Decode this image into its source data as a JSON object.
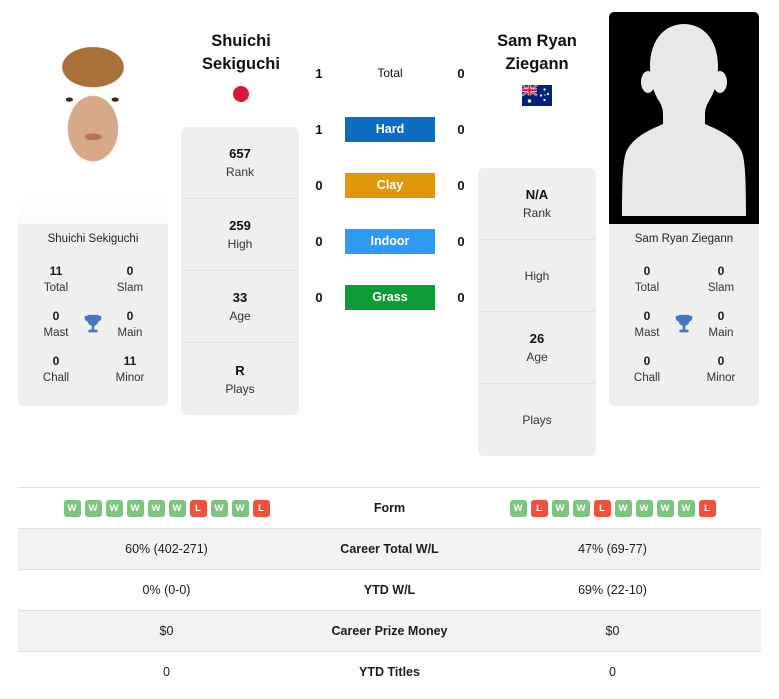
{
  "players": {
    "left": {
      "name": "Shuichi Sekiguchi",
      "name_line1": "Shuichi",
      "name_line2": "Sekiguchi",
      "country_flag": "japan-flag",
      "photo": "player-photo",
      "caption": "Shuichi Sekiguchi",
      "titles": {
        "total": "11",
        "total_label": "Total",
        "slam": "0",
        "slam_label": "Slam",
        "mast": "0",
        "mast_label": "Mast",
        "main": "0",
        "main_label": "Main",
        "chall": "0",
        "chall_label": "Chall",
        "minor": "11",
        "minor_label": "Minor"
      },
      "stats": [
        {
          "value": "657",
          "label": "Rank"
        },
        {
          "value": "259",
          "label": "High"
        },
        {
          "value": "33",
          "label": "Age"
        },
        {
          "value": "R",
          "label": "Plays"
        }
      ],
      "form": [
        "W",
        "W",
        "W",
        "W",
        "W",
        "W",
        "L",
        "W",
        "W",
        "L"
      ],
      "career_total_wl": "60% (402-271)",
      "ytd_wl": "0% (0-0)",
      "career_prize_money": "$0",
      "ytd_titles": "0"
    },
    "right": {
      "name": "Sam Ryan Ziegann",
      "name_line1": "Sam Ryan",
      "name_line2": "Ziegann",
      "country_flag": "australia-flag",
      "photo": "player-photo-placeholder",
      "caption": "Sam Ryan Ziegann",
      "titles": {
        "total": "0",
        "total_label": "Total",
        "slam": "0",
        "slam_label": "Slam",
        "mast": "0",
        "mast_label": "Mast",
        "main": "0",
        "main_label": "Main",
        "chall": "0",
        "chall_label": "Chall",
        "minor": "0",
        "minor_label": "Minor"
      },
      "stats": [
        {
          "value": "N/A",
          "label": "Rank"
        },
        {
          "value": "",
          "label": "High"
        },
        {
          "value": "26",
          "label": "Age"
        },
        {
          "value": "",
          "label": "Plays"
        }
      ],
      "form": [
        "W",
        "L",
        "W",
        "W",
        "L",
        "W",
        "W",
        "W",
        "W",
        "L"
      ],
      "career_total_wl": "47% (69-77)",
      "ytd_wl": "69% (22-10)",
      "career_prize_money": "$0",
      "ytd_titles": "0"
    }
  },
  "head_to_head": [
    {
      "surface": "Total",
      "left": "1",
      "right": "0",
      "color": "",
      "style": "plain"
    },
    {
      "surface": "Hard",
      "left": "1",
      "right": "0",
      "color": "#0d6cbf",
      "style": "filled"
    },
    {
      "surface": "Clay",
      "left": "0",
      "right": "0",
      "color": "#e1970a",
      "style": "filled"
    },
    {
      "surface": "Indoor",
      "left": "0",
      "right": "0",
      "color": "#2f9af5",
      "style": "filled"
    },
    {
      "surface": "Grass",
      "left": "0",
      "right": "0",
      "color": "#0f9b35",
      "style": "filled"
    }
  ],
  "table_rows": [
    {
      "label": "Form",
      "type": "form",
      "left": "",
      "right": ""
    },
    {
      "label": "Career Total W/L",
      "type": "text",
      "left": "60% (402-271)",
      "right": "47% (69-77)"
    },
    {
      "label": "YTD W/L",
      "type": "text",
      "left": "0% (0-0)",
      "right": "69% (22-10)"
    },
    {
      "label": "Career Prize Money",
      "type": "text",
      "left": "$0",
      "right": "$0"
    },
    {
      "label": "YTD Titles",
      "type": "text",
      "left": "0",
      "right": "0"
    }
  ],
  "colors": {
    "hard": "#0d6cbf",
    "clay": "#e1970a",
    "indoor": "#2f9af5",
    "grass": "#0f9b35",
    "win_badge": "#7cc47f",
    "loss_badge": "#f0503c",
    "card_bg": "#efefef",
    "row_shade": "#f2f2f2"
  }
}
